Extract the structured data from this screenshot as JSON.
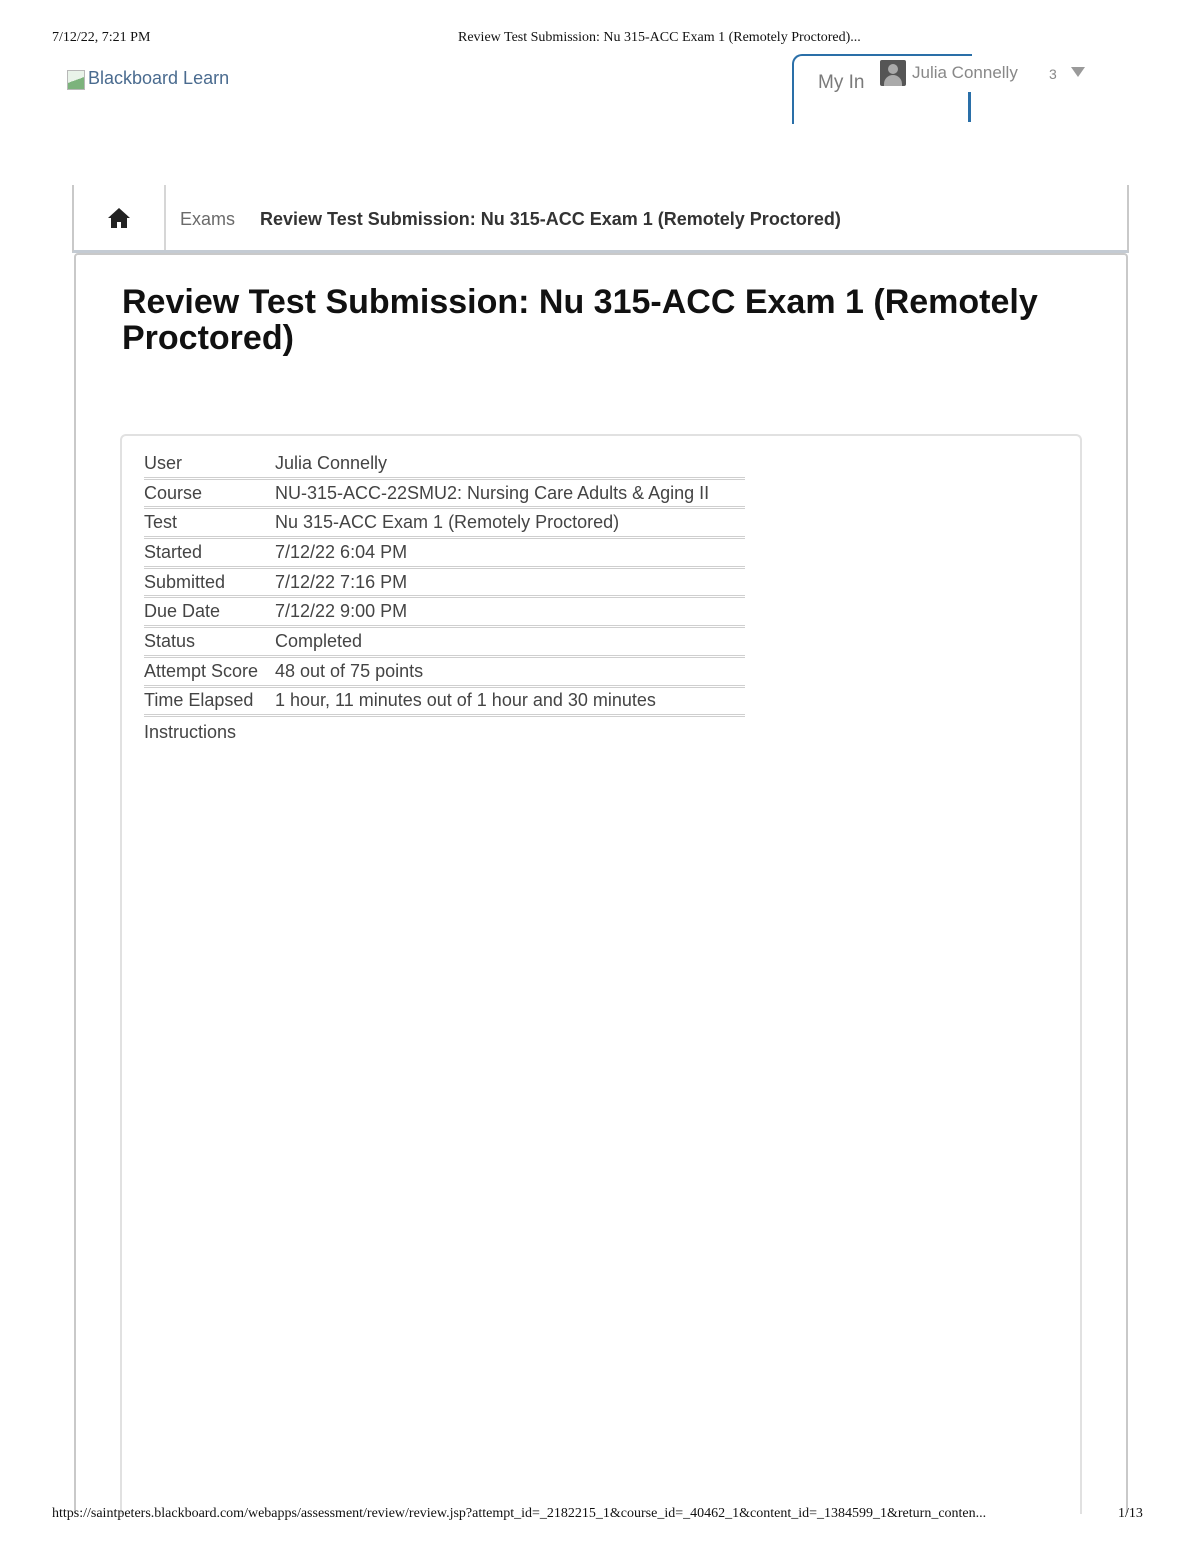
{
  "print": {
    "date": "7/12/22, 7:21 PM",
    "title": "Review Test Submission: Nu 315-ACC Exam 1 (Remotely Proctored)...",
    "url": "https://saintpeters.blackboard.com/webapps/assessment/review/review.jsp?attempt_id=_2182215_1&course_id=_40462_1&content_id=_1384599_1&return_conten...",
    "page": "1/13"
  },
  "header": {
    "logo_alt": "Blackboard Learn",
    "my_institution_label": "My In",
    "user_name": "Julia Connelly",
    "notification_count": "3"
  },
  "breadcrumb": {
    "items": [
      "Exams",
      "Review Test Submission: Nu 315-ACC Exam 1 (Remotely Proctored)"
    ]
  },
  "page_title": "Review Test Submission: Nu 315-ACC Exam 1 (Remotely Proctored)",
  "details": [
    {
      "label": "User",
      "value": "Julia Connelly"
    },
    {
      "label": "Course",
      "value": "NU-315-ACC-22SMU2: Nursing Care Adults & Aging II"
    },
    {
      "label": "Test",
      "value": "Nu 315-ACC Exam 1 (Remotely Proctored)"
    },
    {
      "label": "Started",
      "value": "7/12/22 6:04 PM"
    },
    {
      "label": "Submitted",
      "value": "7/12/22 7:16 PM"
    },
    {
      "label": "Due Date",
      "value": "7/12/22 9:00 PM"
    },
    {
      "label": "Status",
      "value": "Completed"
    },
    {
      "label": "Attempt Score",
      "value": "48 out of 75 points"
    },
    {
      "label": "Time Elapsed",
      "value": "1 hour, 11 minutes out of 1 hour and 30 minutes"
    },
    {
      "label": "Instructions",
      "value": ""
    }
  ],
  "colors": {
    "accent": "#2a6fa8",
    "border": "#c9c9c9"
  },
  "icons": {
    "home": "home-icon",
    "caret": "caret-down-icon",
    "avatar": "avatar"
  }
}
